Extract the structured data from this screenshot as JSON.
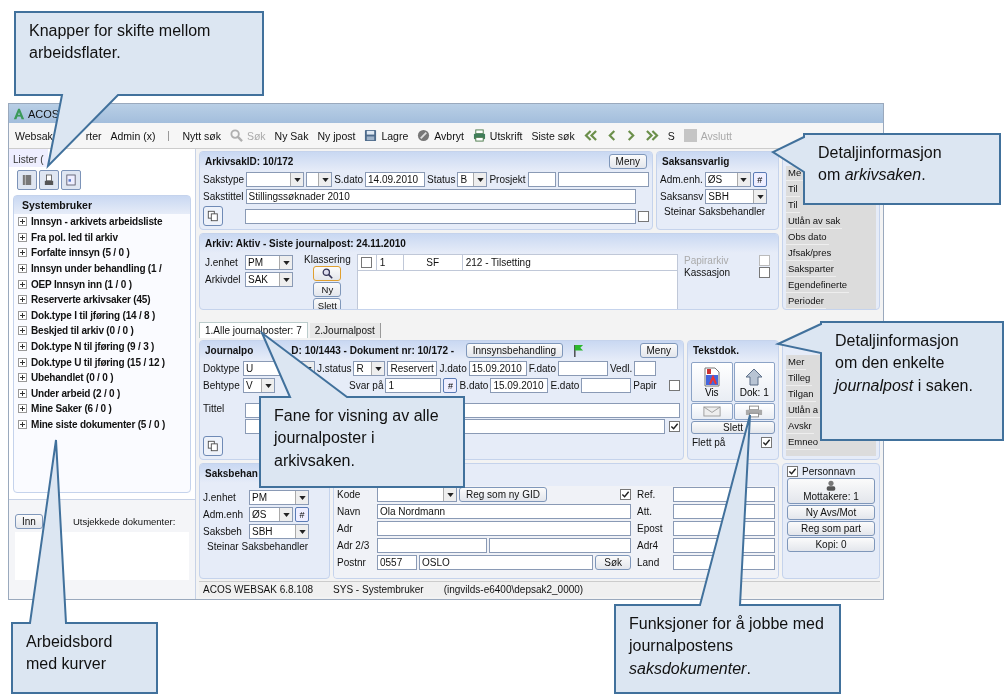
{
  "window": {
    "title": "ACOS"
  },
  "menu": [
    {
      "label": "Websak"
    },
    {
      "label": "rter"
    },
    {
      "label": "Admin (x)"
    }
  ],
  "toolbar": [
    {
      "kind": "plain",
      "label": "Nytt søk",
      "disabled": false
    },
    {
      "kind": "search",
      "label": "Søk",
      "disabled": true
    },
    {
      "kind": "plain",
      "label": "Ny Sak",
      "disabled": false
    },
    {
      "kind": "plain",
      "label": "Ny jpost",
      "disabled": false
    },
    {
      "kind": "save",
      "label": "Lagre",
      "disabled": false
    },
    {
      "kind": "cancel",
      "label": "Avbryt",
      "disabled": false
    },
    {
      "kind": "print",
      "label": "Utskrift",
      "disabled": false
    },
    {
      "kind": "plain",
      "label": "Siste søk",
      "disabled": false
    },
    {
      "kind": "first",
      "disabled": false
    },
    {
      "kind": "prev",
      "disabled": false
    },
    {
      "kind": "next",
      "disabled": false
    },
    {
      "kind": "last",
      "disabled": false
    },
    {
      "kind": "plain",
      "label": "S",
      "disabled": false
    },
    {
      "kind": "stop",
      "label": "Avslutt",
      "disabled": true
    }
  ],
  "sidebar": {
    "tab": "Lister (",
    "tree": {
      "title": "Systembruker",
      "items": [
        {
          "label": "Innsyn - arkivets arbeidsliste",
          "expanded": false
        },
        {
          "label": "Fra pol. led til arkiv",
          "expanded": false
        },
        {
          "label": "Forfalte innsyn (5 / 0 )",
          "expanded": false
        },
        {
          "label": "Innsyn under behandling (1 /",
          "expanded": false
        },
        {
          "label": "OEP Innsyn inn (1 / 0 )",
          "expanded": false
        },
        {
          "label": "Reserverte arkivsaker (45)",
          "expanded": false
        },
        {
          "label": "Dok.type I til jføring (14 / 8 )",
          "expanded": false
        },
        {
          "label": "Beskjed til arkiv (0 / 0 )",
          "expanded": false
        },
        {
          "label": "Dok.type N til jføring (9 / 3 )",
          "expanded": false
        },
        {
          "label": "Dok.type U til jføring (15 / 12 )",
          "expanded": false
        },
        {
          "label": "Ubehandlet (0 / 0 )",
          "expanded": false
        },
        {
          "label": "Under arbeid (2 / 0 )",
          "expanded": false
        },
        {
          "label": "Mine Saker (6 / 0 )",
          "expanded": false
        },
        {
          "label": "Mine siste dokumenter (5 / 0 )",
          "expanded": false
        }
      ]
    },
    "checkout": {
      "button": "Inn",
      "label": "Utsjekkede dokumenter:"
    }
  },
  "arkivsak": {
    "title": "ArkivsakID: 10/172",
    "menu_button": "Meny",
    "sakstype": {
      "label": "Sakstype"
    },
    "sdato": {
      "label": "S.dato",
      "value": "14.09.2010"
    },
    "status": {
      "label": "Status",
      "value": "B"
    },
    "prosjekt": {
      "label": "Prosjekt"
    },
    "sakstittel": {
      "label": "Sakstittel",
      "value": "Stillingssøknader 2010"
    },
    "checked": false
  },
  "saksansvarlig": {
    "title": "Saksansvarlig",
    "adm_enh": {
      "label": "Adm.enh.",
      "value": "ØS",
      "hash_button": "#"
    },
    "saksansv": {
      "label": "Saksansv",
      "value": "SBH"
    },
    "name": "Steinar Saksbehandler"
  },
  "case_menu": {
    "items": [
      "Me",
      "Til",
      "Til",
      "Utlån av sak",
      "Obs dato",
      "Jfsak/pres",
      "Saksparter",
      "Egendefinerte",
      "Perioder"
    ]
  },
  "arkiv": {
    "title": "Arkiv: Aktiv - Siste journalpost: 24.11.2010",
    "j_enhet": {
      "label": "J.enhet",
      "value": "PM"
    },
    "arkivdel": {
      "label": "Arkivdel",
      "value": "SAK"
    },
    "klassering": {
      "label": "Klassering",
      "buttons": [
        "Ny",
        "Slett"
      ],
      "rows": [
        {
          "checked": false,
          "cells": [
            "1",
            "SF",
            "212 - Tilsetting"
          ]
        }
      ]
    },
    "flags": [
      {
        "label": "Papirarkiv",
        "disabled": true,
        "checked": false
      },
      {
        "label": "Kassasjon",
        "disabled": false,
        "checked": false
      }
    ]
  },
  "tabs": [
    {
      "label": "1.Alle journalposter: 7",
      "selected": true
    },
    {
      "label": "2.Journalpost",
      "selected": false
    }
  ],
  "journalpost": {
    "title_parts": [
      "Journalpo",
      "D: 10/1443 - Dokument nr: 10/172 -"
    ],
    "innsyn_button": "Innsynsbehandling",
    "menu_button": "Meny",
    "doktype": {
      "label": "Doktype",
      "value": "U"
    },
    "jstatus": {
      "label": "J.status",
      "value": "R"
    },
    "reservert": "Reservert",
    "jdato": {
      "label": "J.dato",
      "value": "15.09.2010"
    },
    "fdato": {
      "label": "F.dato"
    },
    "vedl": {
      "label": "Vedl."
    },
    "behtype": {
      "label": "Behtype",
      "value": "V"
    },
    "svar_pa": {
      "label": "Svar på",
      "value": "1",
      "hash_button": "#"
    },
    "bdato": {
      "label": "B.dato",
      "value": "15.09.2010"
    },
    "edato": {
      "label": "E.dato"
    },
    "papir": {
      "label": "Papir",
      "checked": false
    },
    "tittel": {
      "label": "Tittel",
      "checked": true
    }
  },
  "tekstdok": {
    "title": "Tekstdok.",
    "buttons": [
      {
        "kind": "view",
        "label": "Vis"
      },
      {
        "kind": "upload",
        "label": "Dok: 1"
      },
      {
        "kind": "mail"
      },
      {
        "kind": "print"
      }
    ],
    "delete": "Slett",
    "merge": {
      "label": "Flett på",
      "checked": true
    }
  },
  "jp_menu": {
    "items": [
      "Mer",
      "Tilleg",
      "Tilgan",
      "Utlån a",
      "Avskr",
      "Emneo"
    ]
  },
  "saksbehandler": {
    "title": "Saksbehan",
    "j_enhet": {
      "label": "J.enhet",
      "value": "PM"
    },
    "adm_enh": {
      "label": "Adm.enh",
      "value": "ØS",
      "hash_button": "#"
    },
    "saksbeh": {
      "label": "Saksbeh",
      "value": "SBH"
    },
    "name": "Steinar Saksbehandler"
  },
  "mottaker": {
    "kode": {
      "label": "Kode"
    },
    "gid_button": "Reg som ny GID",
    "checked": true,
    "navn": {
      "label": "Navn",
      "value": "Ola Nordmann"
    },
    "adr": {
      "label": "Adr"
    },
    "adr23": {
      "label": "Adr 2/3"
    },
    "postnr": {
      "label": "Postnr",
      "value": "0557",
      "place": "OSLO"
    },
    "search_button": "Søk",
    "right_fields": [
      {
        "label": "Ref."
      },
      {
        "label": "Att."
      },
      {
        "label": "Epost"
      },
      {
        "label": "Adr4"
      },
      {
        "label": "Land"
      }
    ]
  },
  "recipients": {
    "personnavn": {
      "label": "Personnavn",
      "checked": true
    },
    "buttons": [
      "Mottakere: 1",
      "Ny Avs/Mot",
      "Reg som part",
      "Kopi: 0"
    ]
  },
  "status_bar": [
    "ACOS WEBSAK 6.8.108",
    "SYS - Systembruker",
    "(ingvilds-e6400\\depsak2_0000)"
  ],
  "callouts": [
    {
      "text": "Knapper for skifte mellom arbeidsflater."
    },
    {
      "text": "Detaljinformasjon om *arkivsaken*."
    },
    {
      "text": "Detaljinformasjon om den enkelte *journalpost* i saken."
    },
    {
      "text": "Fane for visning av alle journalposter i arkivsaken."
    },
    {
      "text": "Arbeidsbord med kurver"
    },
    {
      "text": "Funksjoner for å jobbe med journalpostens *saksdokumenter*."
    }
  ]
}
